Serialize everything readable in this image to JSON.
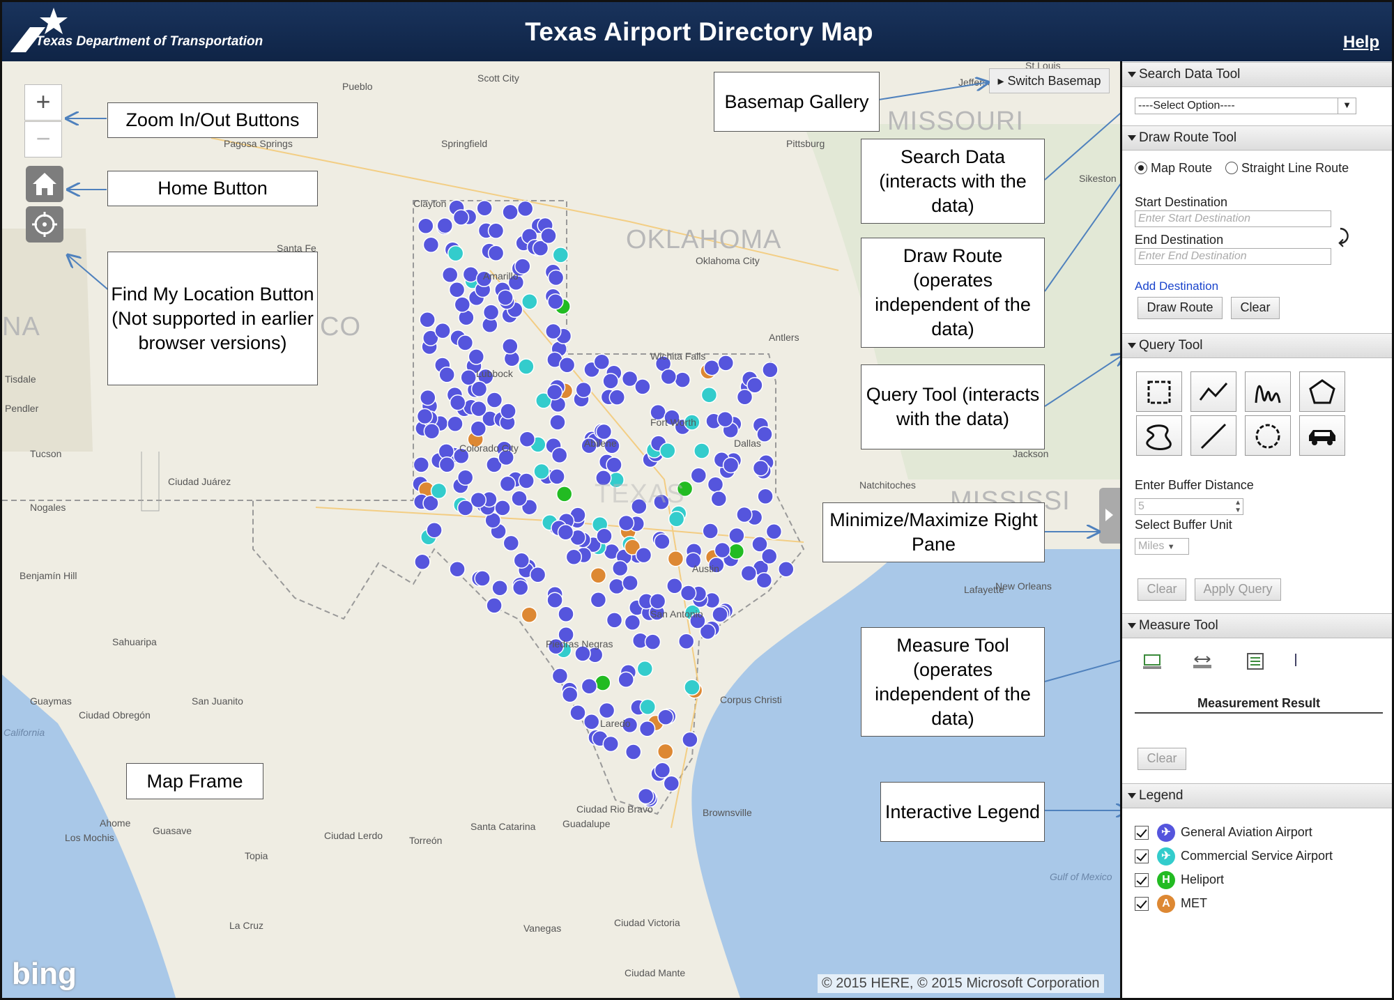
{
  "header": {
    "org_name": "Texas Department of Transportation",
    "title": "Texas Airport Directory Map",
    "help_label": "Help"
  },
  "map": {
    "zoom_in_label": "+",
    "zoom_out_label": "−",
    "home_icon": "home-icon",
    "locate_icon": "crosshair-icon",
    "basemap_label": "Switch Basemap",
    "bing_logo": "bing",
    "copyright": "© 2015 HERE, © 2015 Microsoft Corporation",
    "state_labels": [
      "MISSOURI",
      "OKLAHOMA",
      "TEXAS",
      "MISSISSI",
      "NA",
      "CO"
    ],
    "place_labels": [
      "Pueblo",
      "Scott City",
      "St Louis",
      "Jefferson",
      "Springfield",
      "Pittsburg",
      "Pagosa Springs",
      "Clayton",
      "Santa Fe",
      "Amarillo",
      "Oklahoma City",
      "Sikeston",
      "Antlers",
      "Wichita Falls",
      "Lubbock",
      "Fort Worth",
      "Dallas",
      "Abilene",
      "Colorado City",
      "Jackson",
      "Natchitoches",
      "Tucson",
      "Ciudad Juárez",
      "Nogales",
      "Benjamín Hill",
      "Lafayette",
      "New Orleans",
      "Austin",
      "San Antonio",
      "Piedras Negras",
      "Sahuaripa",
      "Guaymas",
      "San Juanito",
      "Ciudad Obregón",
      "Laredo",
      "Corpus Christi",
      "Ahome",
      "Los Mochis",
      "Guasave",
      "Ciudad Lerdo",
      "Torreón",
      "Santa Catarina",
      "Guadalupe",
      "Ciudad Rio Bravo",
      "Brownsville",
      "Topia",
      "La Cruz",
      "Vanegas",
      "Ciudad Victoria",
      "Ciudad Mante",
      "Gulf of Mexico",
      "Tisdale",
      "Pendler",
      "California"
    ]
  },
  "callouts": {
    "zoom": "Zoom In/Out Buttons",
    "home": "Home Button",
    "locate": "Find My Location Button (Not supported in earlier browser versions)",
    "basemap": "Basemap Gallery",
    "search": "Search Data (interacts with the data)",
    "route": "Draw Route (operates independent of the data)",
    "query": "Query Tool (interacts with the data)",
    "minmax": "Minimize/Maximize Right Pane",
    "measure": "Measure Tool (operates independent of the data)",
    "frame": "Map Frame",
    "legend": "Interactive Legend"
  },
  "pane": {
    "search": {
      "header": "Search Data Tool",
      "select_value": "----Select Option----"
    },
    "route": {
      "header": "Draw Route Tool",
      "radio_map": "Map Route",
      "radio_straight": "Straight Line Route",
      "start_label": "Start Destination",
      "start_placeholder": "Enter Start Destination",
      "end_label": "End Destination",
      "end_placeholder": "Enter End Destination",
      "add_label": "Add Destination",
      "draw_label": "Draw Route",
      "clear_label": "Clear"
    },
    "query": {
      "header": "Query Tool",
      "tools": [
        "rectangle-select-icon",
        "polyline-select-icon",
        "freehand-line-icon",
        "polygon-select-icon",
        "freehand-polygon-icon",
        "line-select-icon",
        "circle-select-icon",
        "car-icon"
      ],
      "buffer_label": "Enter Buffer Distance",
      "buffer_value": "5",
      "unit_label": "Select Buffer Unit",
      "unit_value": "Miles",
      "clear_label": "Clear",
      "apply_label": "Apply Query"
    },
    "measure": {
      "header": "Measure Tool",
      "tools": [
        "area-measure-icon",
        "distance-measure-icon",
        "location-measure-icon"
      ],
      "result_label": "Measurement Result",
      "clear_label": "Clear"
    },
    "legend": {
      "header": "Legend",
      "items": [
        {
          "label": "General Aviation Airport",
          "color": "#5555dd",
          "icon": "airplane-icon"
        },
        {
          "label": "Commercial Service Airport",
          "color": "#33cccc",
          "icon": "airplane-icon"
        },
        {
          "label": "Heliport",
          "color": "#22bb22",
          "icon": "heliport-icon",
          "glyph": "H"
        },
        {
          "label": "MET",
          "color": "#dd8833",
          "icon": "met-icon",
          "glyph": "A"
        }
      ]
    }
  }
}
